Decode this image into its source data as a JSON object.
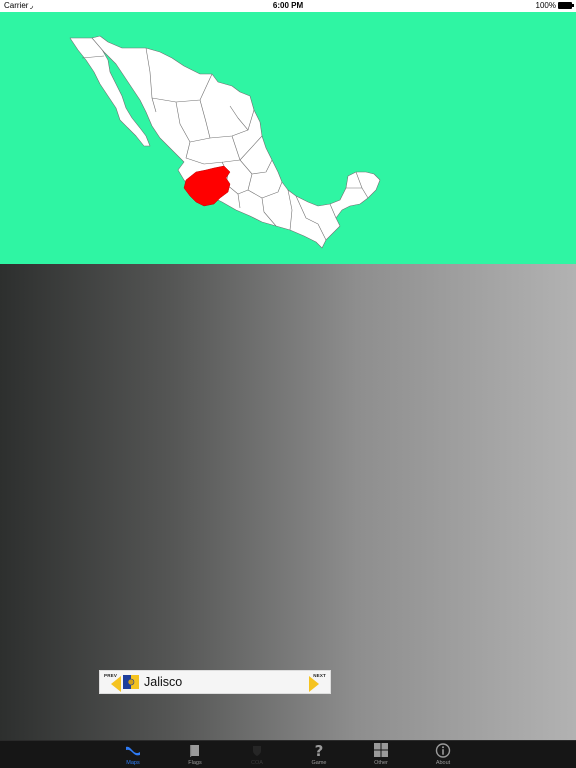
{
  "status_bar": {
    "carrier": "Carrier",
    "time": "6:00 PM",
    "battery": "100%"
  },
  "map": {
    "background_color": "#2ff5a3",
    "land_color": "#ffffff",
    "border_color": "#707070",
    "highlight_color": "#ff0000",
    "highlighted_region": "Jalisco"
  },
  "selector": {
    "prev_label": "PREV",
    "next_label": "NEXT",
    "state_name": "Jalisco",
    "arrow_color": "#f5c320"
  },
  "tabs": [
    {
      "label": "Maps",
      "icon": "maps-icon",
      "state": "active"
    },
    {
      "label": "Flags",
      "icon": "flags-icon",
      "state": "normal"
    },
    {
      "label": "COA",
      "icon": "coa-icon",
      "state": "disabled"
    },
    {
      "label": "Game",
      "icon": "question-icon",
      "state": "normal"
    },
    {
      "label": "Other",
      "icon": "grid-icon",
      "state": "normal"
    },
    {
      "label": "About",
      "icon": "info-icon",
      "state": "normal"
    }
  ],
  "accent_color": "#2f7cf6"
}
